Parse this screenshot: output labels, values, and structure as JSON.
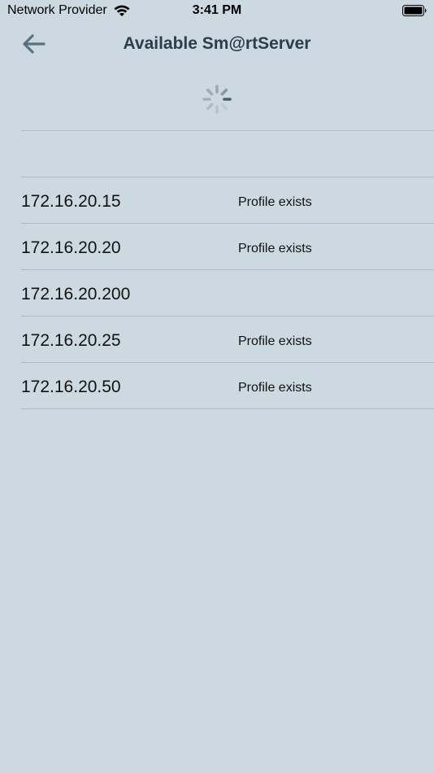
{
  "status_bar": {
    "carrier": "Network Provider",
    "time": "3:41 PM",
    "wifi_icon": "wifi-icon",
    "battery_icon": "battery-icon"
  },
  "header": {
    "back_icon": "arrow-left-icon",
    "title": "Available Sm@rtServer"
  },
  "loading": {
    "spinner_icon": "activity-spinner-icon"
  },
  "servers": [
    {
      "ip": "",
      "status": ""
    },
    {
      "ip": "172.16.20.15",
      "status": "Profile exists"
    },
    {
      "ip": "172.16.20.20",
      "status": "Profile exists"
    },
    {
      "ip": "172.16.20.200",
      "status": ""
    },
    {
      "ip": "172.16.20.25",
      "status": "Profile exists"
    },
    {
      "ip": "172.16.20.50",
      "status": "Profile exists"
    }
  ],
  "colors": {
    "background": "#ccd9e1",
    "title": "#2b3e4c",
    "back_arrow": "#5b7080",
    "separator": "#aebcc6"
  }
}
